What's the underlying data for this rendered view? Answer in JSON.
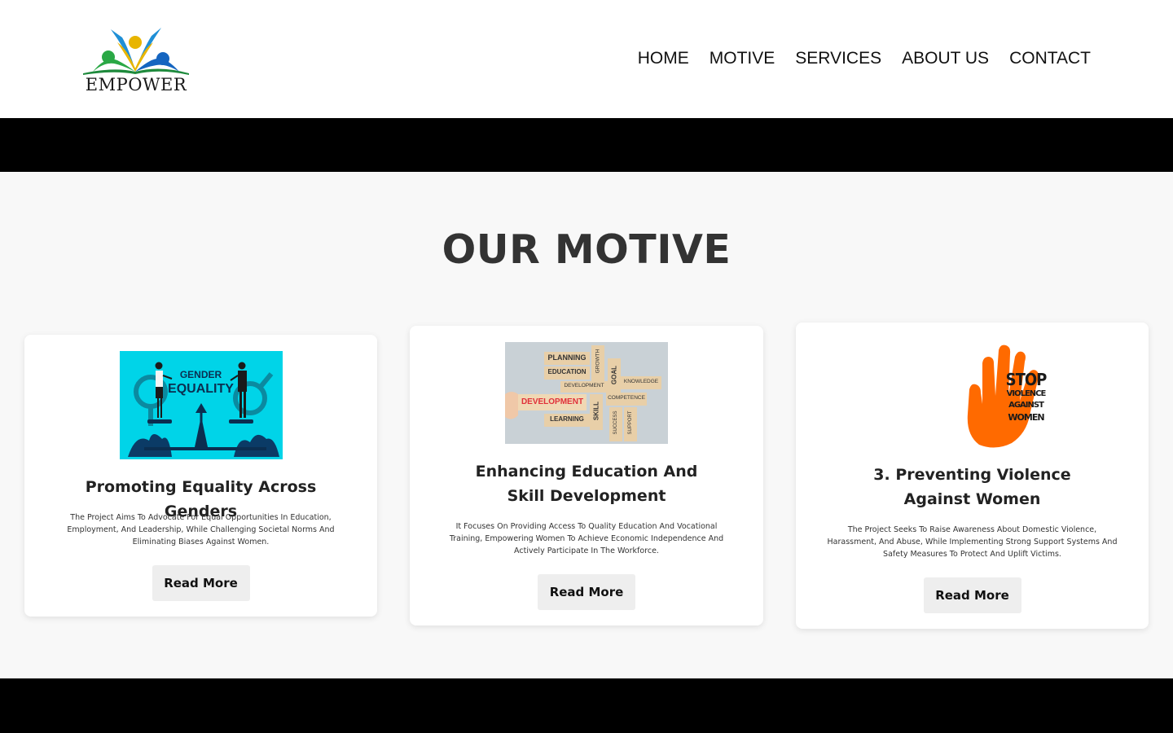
{
  "brand": {
    "name": "EMPOWER"
  },
  "nav": {
    "items": [
      {
        "label": "HOME"
      },
      {
        "label": "MOTIVE"
      },
      {
        "label": "SERVICES"
      },
      {
        "label": "ABOUT US"
      },
      {
        "label": "CONTACT"
      }
    ]
  },
  "motive": {
    "title": "OUR MOTIVE",
    "cards": [
      {
        "title": "Promoting Equality Across Genders",
        "description": "The Project Aims To Advocate For Equal Opportunities In Education, Employment, And Leadership, While Challenging Societal Norms And Eliminating Biases Against Women.",
        "button": "Read More",
        "image": {
          "line1": "GENDER",
          "line2": "EQUALITY"
        }
      },
      {
        "title": "Enhancing Education And Skill Development",
        "description": "It Focuses On Providing Access To Quality Education And Vocational Training, Empowering Women To Achieve Economic Independence And Actively Participate In The Workforce.",
        "button": "Read More",
        "image": {
          "words": [
            "PLANNING",
            "EDUCATION",
            "DEVELOPMENT",
            "DEVELOPMENT",
            "LEARNING",
            "GROWTH",
            "GOAL",
            "SKILL",
            "KNOWLEDGE",
            "COMPETENCE",
            "SUCCESS",
            "SUPPORT"
          ]
        }
      },
      {
        "title": "3. Preventing Violence Against Women",
        "description": "The Project Seeks To Raise Awareness About Domestic Violence, Harassment, And Abuse, While Implementing Strong Support Systems And Safety Measures To Protect And Uplift Victims.",
        "button": "Read More",
        "image": {
          "line1": "STOP",
          "line2": "VIOLENCE",
          "line3": "AGAINST",
          "line4": "WOMEN"
        }
      }
    ]
  },
  "colors": {
    "page_bg": "#f8f8f8",
    "bar": "#000000",
    "heading": "#333333",
    "button_bg": "#eeeeee",
    "cyan": "#00d4e8",
    "orange": "#ff6a00"
  }
}
